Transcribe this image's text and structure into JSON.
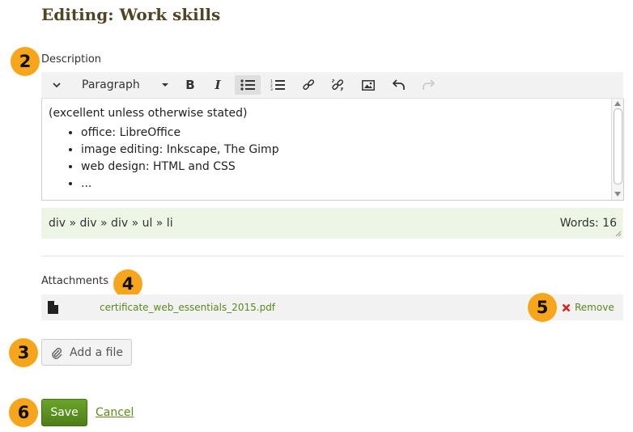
{
  "page": {
    "title": "Editing: Work skills"
  },
  "badges": {
    "description": "2",
    "attachments": "4",
    "add_file": "3",
    "remove": "5",
    "save": "6"
  },
  "description": {
    "label": "Description",
    "toolbar": {
      "format_select": "Paragraph"
    },
    "content": {
      "intro": "(excellent unless otherwise stated)",
      "items": [
        "office: LibreOffice",
        "image editing: Inkscape, The Gimp",
        "web design: HTML and CSS",
        "..."
      ]
    },
    "status": {
      "path": "div » div » div » ul » li",
      "word_count": "Words: 16"
    }
  },
  "attachments": {
    "label": "Attachments",
    "file": {
      "name": "certificate_web_essentials_2015.pdf",
      "remove_label": "Remove"
    },
    "add_button": "Add a file"
  },
  "actions": {
    "save": "Save",
    "cancel": "Cancel"
  }
}
